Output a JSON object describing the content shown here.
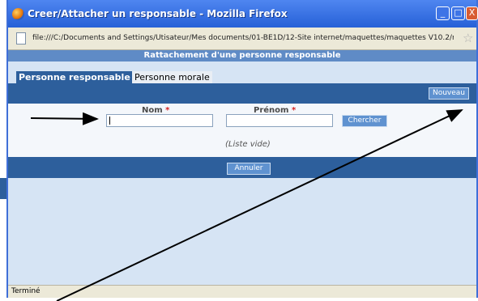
{
  "window": {
    "title": "Creer/Attacher un responsable - Mozilla Firefox",
    "buttons": {
      "minimize": "_",
      "maximize": "□",
      "close": "X"
    }
  },
  "address_bar": {
    "url": "file:///C:/Documents and Settings/Utisateur/Mes documents/01-BE1D/12-Site internet/maquettes/maquettes V10.2/maqu"
  },
  "page": {
    "header": "Rattachement d'une personne responsable",
    "tabs": [
      {
        "label": "Personne responsable",
        "active": true
      },
      {
        "label": "Personne morale",
        "active": false
      }
    ],
    "new_button": "Nouveau",
    "form": {
      "nom_label": "Nom",
      "prenom_label": "Prénom",
      "required_marker": "*",
      "nom_value": "",
      "prenom_value": "",
      "search_button": "Chercher"
    },
    "empty_list_text": "(Liste vide)",
    "cancel_button": "Annuler"
  },
  "status_bar": {
    "text": "Terminé"
  },
  "colors": {
    "title_bar": "#2660d7",
    "page_header": "#5f8bc6",
    "dark_blue_bar": "#2d5f9c",
    "required": "#d62020"
  }
}
